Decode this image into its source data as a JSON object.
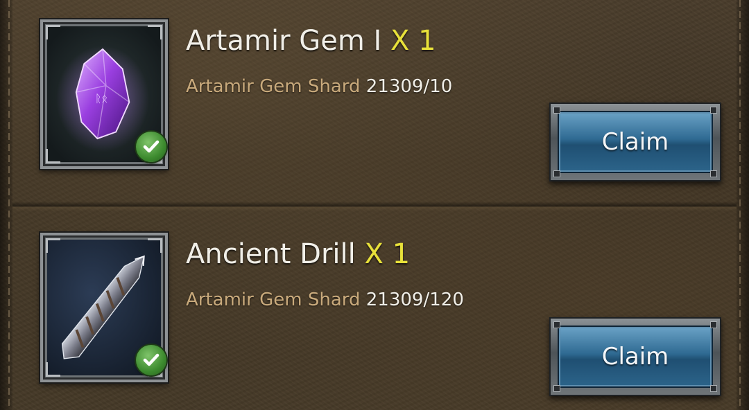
{
  "rewards": [
    {
      "title": "Artamir Gem I",
      "quantity": "X 1",
      "requirement_name": "Artamir Gem Shard",
      "requirement_count": "21309/10",
      "claim_label": "Claim",
      "icon": "purple-gem-icon",
      "claimable": true
    },
    {
      "title": "Ancient Drill",
      "quantity": "X 1",
      "requirement_name": "Artamir Gem Shard",
      "requirement_count": "21309/120",
      "claim_label": "Claim",
      "icon": "drill-icon",
      "claimable": true
    }
  ],
  "colors": {
    "title": "#f1efe8",
    "quantity": "#e8e13a",
    "requirement_name": "#c9aa7c",
    "claim_button": "#2f6a92",
    "check_badge": "#3c8a2e"
  }
}
